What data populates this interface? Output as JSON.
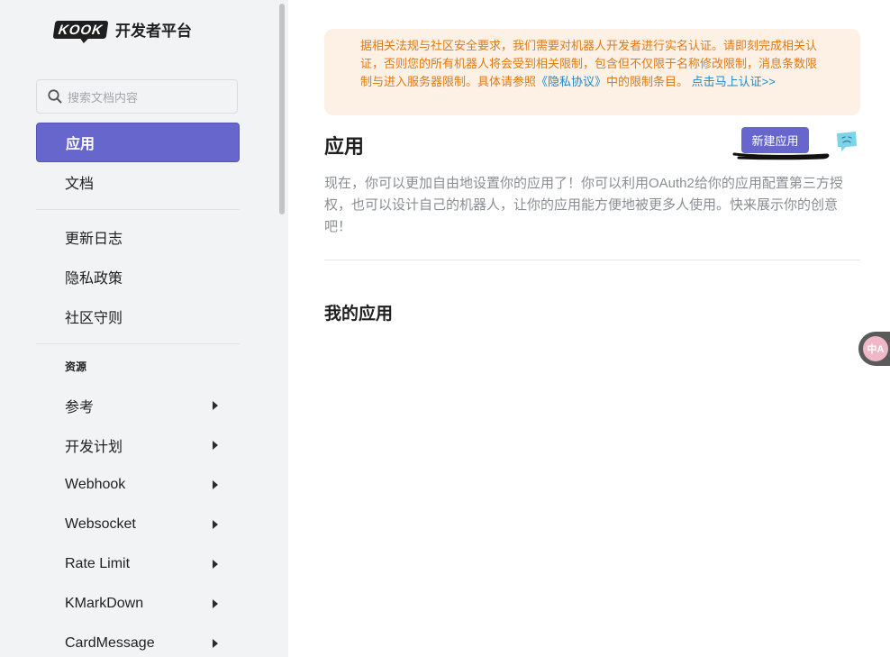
{
  "brand": {
    "logo_text": "KOOK",
    "title": "开发者平台"
  },
  "search": {
    "placeholder": "搜索文档内容"
  },
  "sidebar": {
    "items": [
      {
        "label": "应用"
      },
      {
        "label": "文档"
      },
      {
        "label": "更新日志"
      },
      {
        "label": "隐私政策"
      },
      {
        "label": "社区守则"
      }
    ],
    "section_label": "资源",
    "resources": [
      {
        "label": "参考"
      },
      {
        "label": "开发计划"
      },
      {
        "label": "Webhook"
      },
      {
        "label": "Websocket"
      },
      {
        "label": "Rate Limit"
      },
      {
        "label": "KMarkDown"
      },
      {
        "label": "CardMessage"
      }
    ]
  },
  "notice": {
    "text_before": "据相关法规与社区安全要求，我们需要对机器人开发者进行实名认证。请即刻完成相关认证，否则您的所有机器人将会受到相关限制，包含但不仅限于名称修改限制，消息条数限制与进入服务器限制。具体请参照",
    "privacy_link": "《隐私协议》",
    "text_after": "中的限制条目。",
    "verify_link": "点击马上认证>>"
  },
  "main": {
    "title": "应用",
    "new_button": "新建应用",
    "description": "现在，你可以更加自由地设置你的应用了！你可以利用OAuth2给你的应用配置第三方授权，也可以设计自己的机器人，让你的应用能方便地被更多人使用。快来展示你的创意吧！",
    "my_apps_title": "我的应用"
  },
  "translate": {
    "label": "中A"
  },
  "colors": {
    "accent": "#6766cc",
    "notice_bg": "#fdf1e6",
    "notice_text": "#e07a14",
    "link": "#1e88c8"
  }
}
